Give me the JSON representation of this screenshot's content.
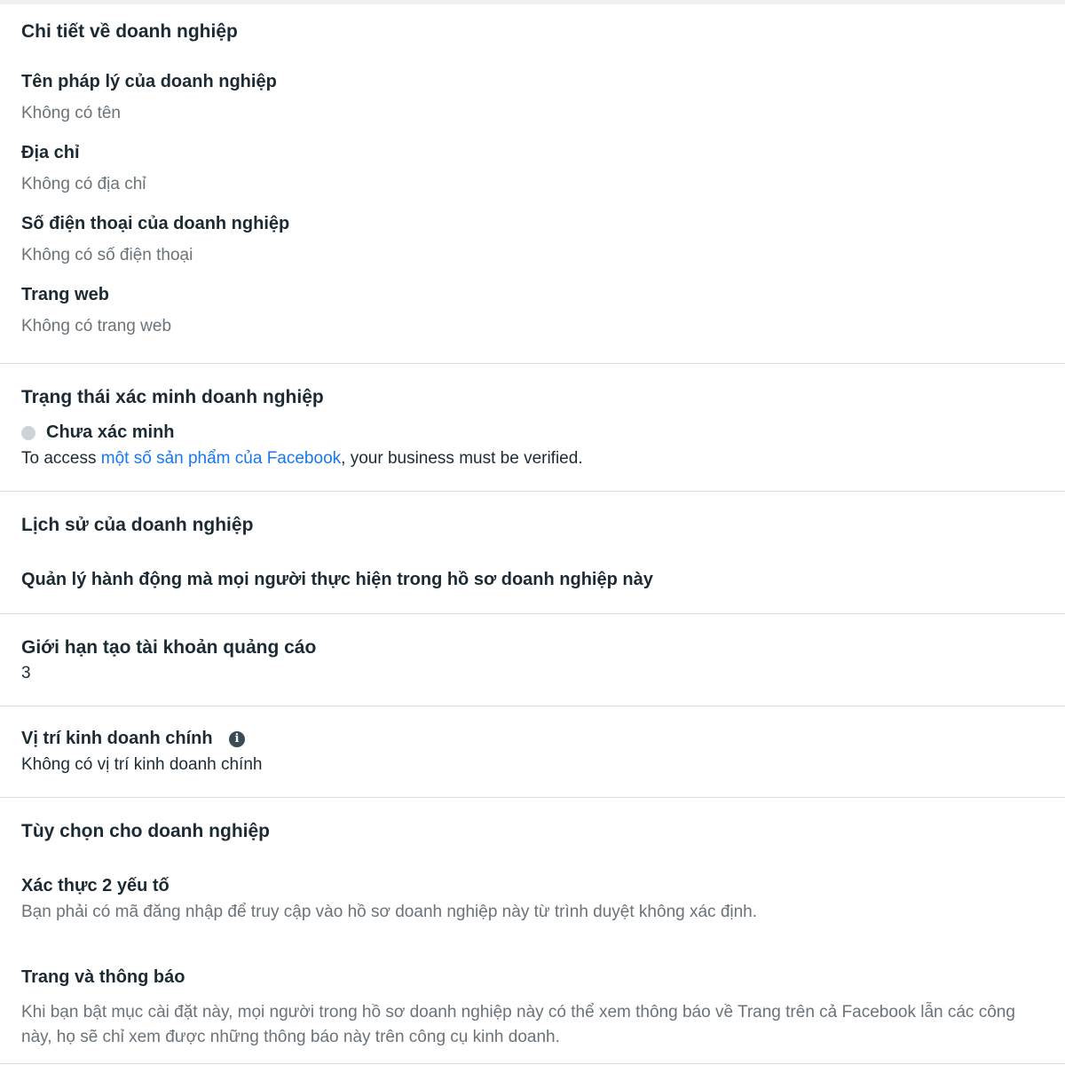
{
  "business_details": {
    "heading": "Chi tiết về doanh nghiệp",
    "legal_name_label": "Tên pháp lý của doanh nghiệp",
    "legal_name_value": "Không có tên",
    "address_label": "Địa chỉ",
    "address_value": "Không có địa chỉ",
    "phone_label": "Số điện thoại của doanh nghiệp",
    "phone_value": "Không có số điện thoại",
    "website_label": "Trang web",
    "website_value": "Không có trang web"
  },
  "verification": {
    "heading": "Trạng thái xác minh doanh nghiệp",
    "status": "Chưa xác minh",
    "status_color": "#cbd2d9",
    "text_before": "To access ",
    "link_text": "một số sản phẩm của Facebook",
    "text_after": ", your business must be verified.",
    "link_color": "#1877f2"
  },
  "history": {
    "heading": "Lịch sử của doanh nghiệp",
    "action_link": "Quản lý hành động mà mọi người thực hiện trong hồ sơ doanh nghiệp này"
  },
  "ad_account_limit": {
    "heading": "Giới hạn tạo tài khoản quảng cáo",
    "value": "3"
  },
  "primary_location": {
    "heading": "Vị trí kinh doanh chính",
    "info_icon": "info-icon",
    "value": "Không có vị trí kinh doanh chính"
  },
  "business_options": {
    "heading": "Tùy chọn cho doanh nghiệp",
    "two_factor_label": "Xác thực 2 yếu tố",
    "two_factor_desc": "Bạn phải có mã đăng nhập để truy cập vào hồ sơ doanh nghiệp này từ trình duyệt không xác định.",
    "pages_notifications_label": "Trang và thông báo",
    "pages_notifications_desc_line1": "Khi bạn bật mục cài đặt này, mọi người trong hồ sơ doanh nghiệp này có thể xem thông báo về Trang trên cả Facebook lẫn các công",
    "pages_notifications_desc_line2": "này, họ sẽ chỉ xem được những thông báo này trên công cụ kinh doanh."
  }
}
